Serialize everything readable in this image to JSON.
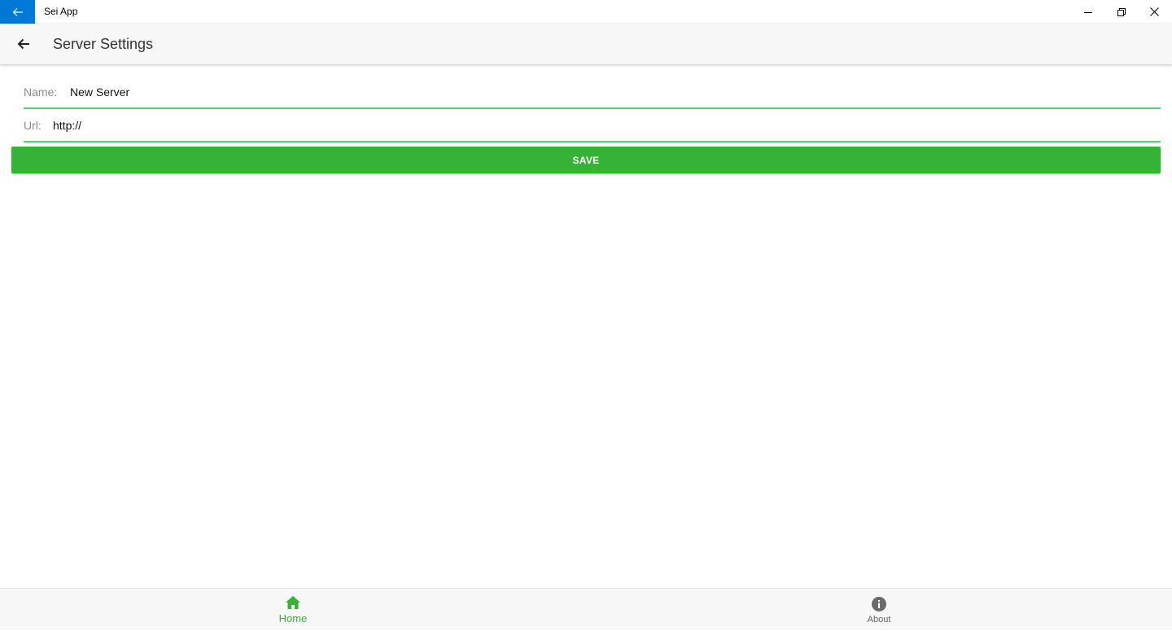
{
  "window": {
    "title": "Sei App",
    "accent": "#0078d7",
    "controls": [
      "minimize-icon",
      "restore-icon",
      "close-icon"
    ]
  },
  "header": {
    "title": "Server Settings",
    "back_icon": "arrow-left-icon"
  },
  "form": {
    "name_label": "Name:",
    "name_value": "New Server",
    "url_label": "Url:",
    "url_value": "http://",
    "underline_color": "#4cd26e"
  },
  "save_button": {
    "label": "SAVE",
    "color": "#36b337"
  },
  "bottom_nav": {
    "items": [
      {
        "label": "Home",
        "icon": "home-icon",
        "active": true,
        "color": "#36b337"
      },
      {
        "label": "About",
        "icon": "info-icon",
        "active": false,
        "color": "#5f5f5f"
      }
    ]
  }
}
